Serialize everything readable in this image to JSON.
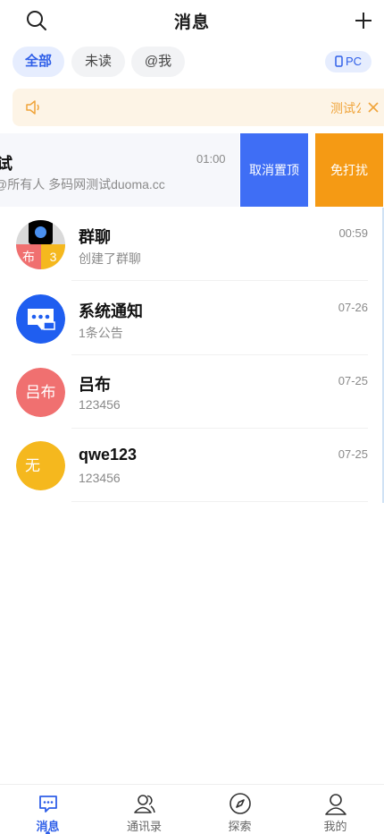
{
  "header": {
    "title": "消息"
  },
  "filters": {
    "all": "全部",
    "unread": "未读",
    "mention": "@我",
    "pc": "PC"
  },
  "notice": {
    "text": "测试公告"
  },
  "swiped": {
    "name": "试",
    "sub": "@所有人 多码网测试duoma.cc",
    "time": "01:00",
    "unpin_label": "取消置顶",
    "mute_label": "免打扰"
  },
  "chats": [
    {
      "name": "群聊",
      "sub": "创建了群聊",
      "time": "00:59",
      "avatar_bl": "布",
      "avatar_br": "3"
    },
    {
      "name": "系统通知",
      "sub": "1条公告",
      "time": "07-26"
    },
    {
      "name": "吕布",
      "sub": "123456",
      "time": "07-25",
      "avatar_text": "吕布",
      "avatar_color": "#f07070"
    },
    {
      "name": "qwe123",
      "sub": "123456",
      "time": "07-25",
      "avatar_text": "无",
      "avatar_color": "#f5b81e"
    }
  ],
  "tabbar": {
    "messages": "消息",
    "contacts": "通讯录",
    "explore": "探索",
    "mine": "我的"
  },
  "colors": {
    "accent": "#2f5fe8",
    "unpin": "#3f6ef5",
    "mute": "#f59a14",
    "notice_bg": "#fdf4e6",
    "notice_text": "#f0a43a"
  }
}
